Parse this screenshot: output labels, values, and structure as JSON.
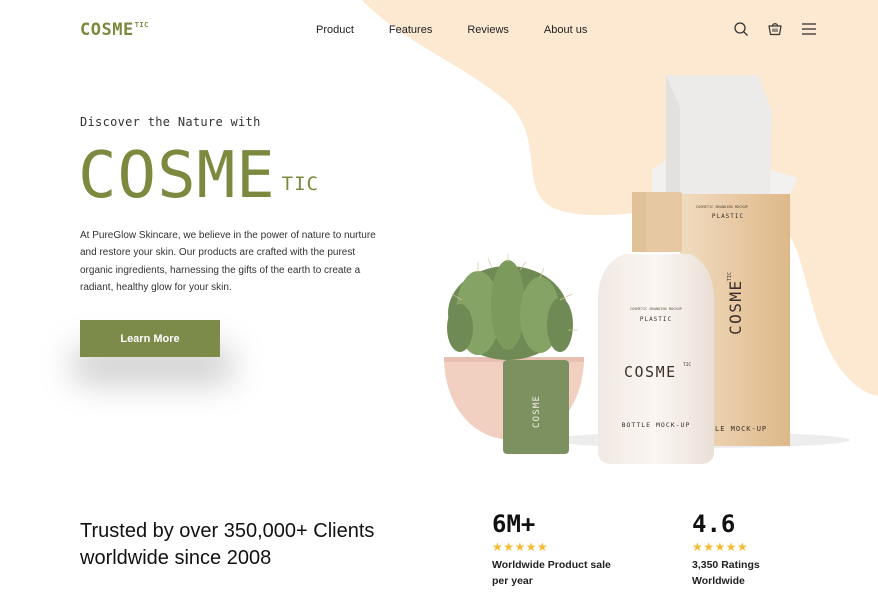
{
  "brand": {
    "logo": "COSME",
    "logo_sup": "TIC",
    "accent_color": "#7c8a3f",
    "blob_color": "#fde9d2"
  },
  "nav": {
    "items": [
      "Product",
      "Features",
      "Reviews",
      "About us"
    ]
  },
  "header_icons": [
    "search-icon",
    "cart-icon",
    "menu-icon"
  ],
  "hero": {
    "tagline": "Discover the Nature with",
    "title": "COSME",
    "title_sup": "TIC",
    "body": "At PureGlow Skincare, we believe in the power of nature to nurture and restore your skin. Our products are crafted with the purest organic ingredients, harnessing the gifts of the earth to create a radiant, healthy glow for your skin.",
    "cta": "Learn More"
  },
  "product_image": {
    "box_top": "COSMETIC BRANDING MOCKUP",
    "box_sub": "PLASTIC",
    "box_brand": "COSME",
    "box_brand_sup": "TIC",
    "box_bottom": "LE MOCK-UP",
    "bottle_top": "COSMETIC BRANDING MOCKUP",
    "bottle_sub": "PLASTIC",
    "bottle_brand": "COSME",
    "bottle_brand_sup": "TIC",
    "bottle_bottom": "BOTTLE MOCK-UP",
    "card_brand": "COSME"
  },
  "stats": {
    "trusted_text": "Trusted by over 350,000+ Clients worldwide since 2008",
    "items": [
      {
        "number": "6M+",
        "stars": "★★★★★",
        "label": "Worldwide Product sale per year"
      },
      {
        "number": "4.6",
        "stars": "★★★★★",
        "label": "3,350 Ratings Worldwide"
      }
    ],
    "star_color": "#f4bb2e"
  }
}
